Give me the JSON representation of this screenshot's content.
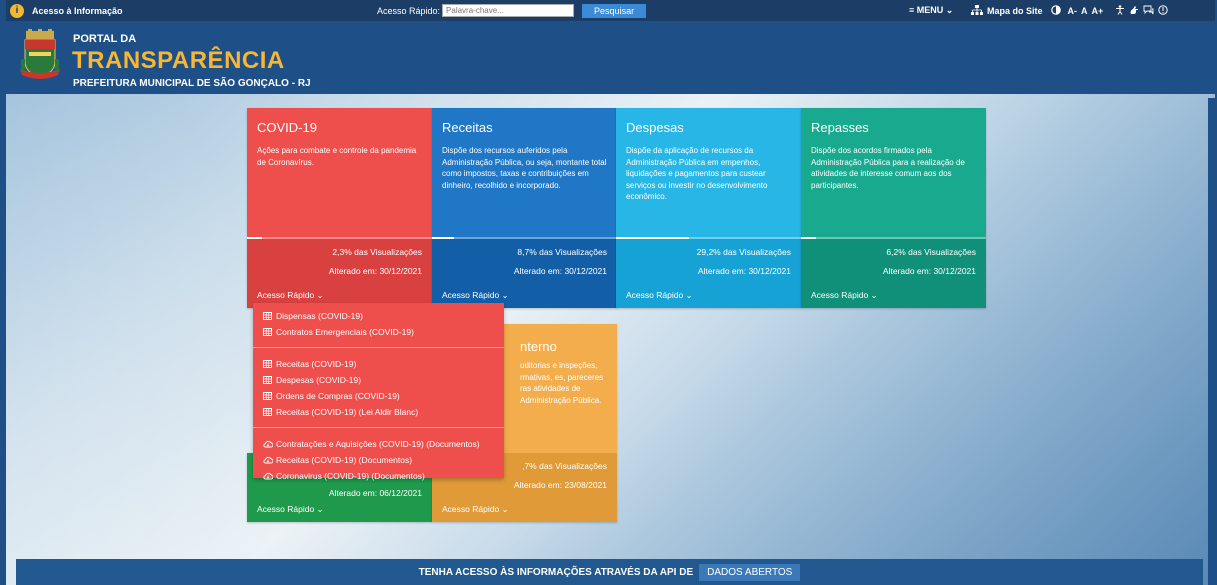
{
  "topbar": {
    "access_label": "Acesso à Informação",
    "quick_label": "Acesso Rápido:",
    "search_placeholder": "Palavra-chave...",
    "search_button": "Pesquisar",
    "menu_label": "≡ MENU ⌄",
    "sitemap_label": "Mapa do Site",
    "font_small": "A-",
    "font_normal": "A",
    "font_large": "A+"
  },
  "header": {
    "portal_da": "PORTAL DA",
    "title": "TRANSPARÊNCIA",
    "subtitle": "PREFEITURA MUNICIPAL DE SÃO GONÇALO - RJ"
  },
  "cards": [
    {
      "title": "COVID-19",
      "desc": "Ações para combate e controle da pandemia de Coronavírus.",
      "views": "2,3% das Visualizações",
      "altered": "Alterado em: 30/12/2021",
      "quick": "Acesso Rápido",
      "progress": 0.023
    },
    {
      "title": "Receitas",
      "desc": "Dispõe dos recursos auferidos pela Administração Pública, ou seja, montante total como impostos, taxas e contribuições em dinheiro, recolhido e incorporado.",
      "views": "8,7% das Visualizações",
      "altered": "Alterado em: 30/12/2021",
      "quick": "Acesso Rápido",
      "progress": 0.087
    },
    {
      "title": "Despesas",
      "desc": "Dispõe da aplicação de recursos da Administração Pública em empenhos, liquidações e pagamentos para custear serviços ou investir no desenvolvimento econômico.",
      "views": "29,2% das Visualizações",
      "altered": "Alterado em: 30/12/2021",
      "quick": "Acesso Rápido",
      "progress": 0.292
    },
    {
      "title": "Repasses",
      "desc": "Dispõe dos acordos firmados pela Administração Pública para a realização de atividades de interesse comum aos dos participantes.",
      "views": "6,2% das Visualizações",
      "altered": "Alterado em: 30/12/2021",
      "quick": "Acesso Rápido",
      "progress": 0.062
    }
  ],
  "cards2": [
    {
      "altered": "Alterado em: 06/12/2021",
      "quick": "Acesso Rápido"
    },
    {
      "title": "nterno",
      "desc": "uditorias e inspeções, rmativas, es, pareceres ras atividades de Administração Pública.",
      "views": ",7% das Visualizações",
      "altered": "Alterado em: 23/08/2021",
      "quick": "Acesso Rápido"
    }
  ],
  "dropdown": {
    "group1": [
      "Dispensas (COVID-19)",
      "Contratos Emergenciais (COVID-19)"
    ],
    "group2": [
      "Receitas (COVID-19)",
      "Despesas (COVID-19)",
      "Ordens de Compras (COVID-19)",
      "Receitas (COVID-19) (Lei Aldir Blanc)"
    ],
    "group3": [
      "Contratações e Aquisições (COVID-19) (Documentos)",
      "Receitas (COVID-19) (Documentos)",
      "Coronavirus (COVID-19) (Documentos)"
    ]
  },
  "api": {
    "text": "TENHA ACESSO ÀS INFORMAÇÕES ATRAVÉS DA API DE",
    "tag": "DADOS ABERTOS"
  }
}
